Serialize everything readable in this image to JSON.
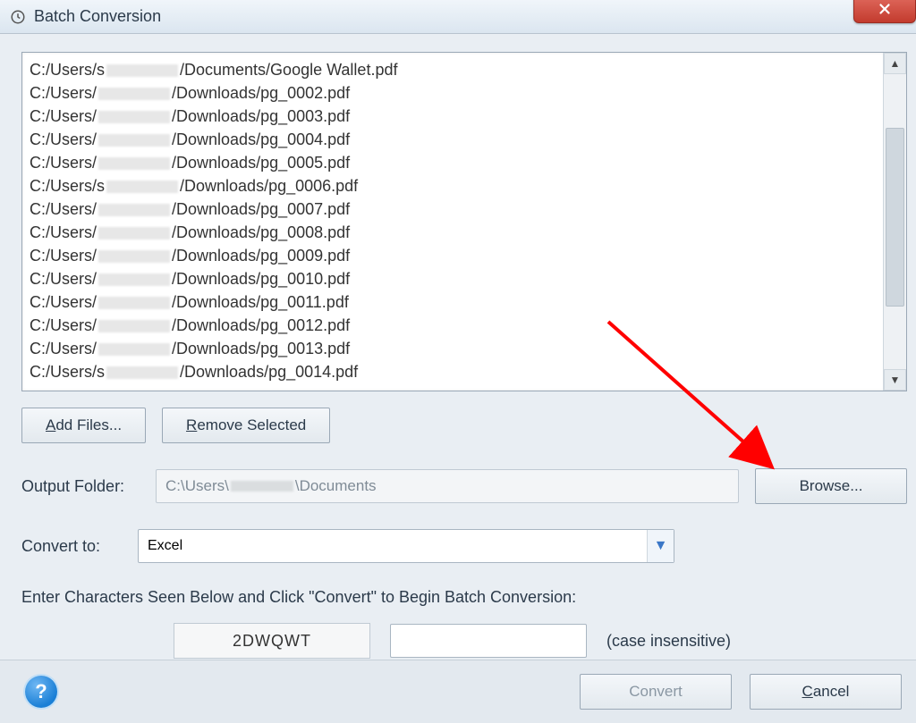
{
  "window": {
    "title": "Batch Conversion"
  },
  "file_list": {
    "items": [
      {
        "prefix": "C:/Users/s",
        "suffix": "/Documents/Google Wallet.pdf"
      },
      {
        "prefix": "C:/Users/",
        "suffix": "/Downloads/pg_0002.pdf"
      },
      {
        "prefix": "C:/Users/",
        "suffix": "/Downloads/pg_0003.pdf"
      },
      {
        "prefix": "C:/Users/",
        "suffix": "/Downloads/pg_0004.pdf"
      },
      {
        "prefix": "C:/Users/",
        "suffix": "/Downloads/pg_0005.pdf"
      },
      {
        "prefix": "C:/Users/s",
        "suffix": "/Downloads/pg_0006.pdf"
      },
      {
        "prefix": "C:/Users/",
        "suffix": "/Downloads/pg_0007.pdf"
      },
      {
        "prefix": "C:/Users/",
        "suffix": "/Downloads/pg_0008.pdf"
      },
      {
        "prefix": "C:/Users/",
        "suffix": "/Downloads/pg_0009.pdf"
      },
      {
        "prefix": "C:/Users/",
        "suffix": "/Downloads/pg_0010.pdf"
      },
      {
        "prefix": "C:/Users/",
        "suffix": "/Downloads/pg_0011.pdf"
      },
      {
        "prefix": "C:/Users/",
        "suffix": "/Downloads/pg_0012.pdf"
      },
      {
        "prefix": "C:/Users/",
        "suffix": "/Downloads/pg_0013.pdf"
      },
      {
        "prefix": "C:/Users/s",
        "suffix": "/Downloads/pg_0014.pdf"
      }
    ]
  },
  "buttons": {
    "add_files": "Add Files...",
    "remove_selected": "Remove Selected",
    "browse": "Browse...",
    "convert": "Convert",
    "cancel": "Cancel"
  },
  "output_folder": {
    "label": "Output Folder:",
    "value_prefix": "C:\\Users\\",
    "value_suffix": "\\Documents"
  },
  "convert_to": {
    "label": "Convert to:",
    "value": "Excel"
  },
  "captcha": {
    "instruction": "Enter Characters Seen Below and Click \"Convert\" to Begin Batch Conversion:",
    "code": "2DWQWT",
    "note": "(case insensitive)"
  }
}
